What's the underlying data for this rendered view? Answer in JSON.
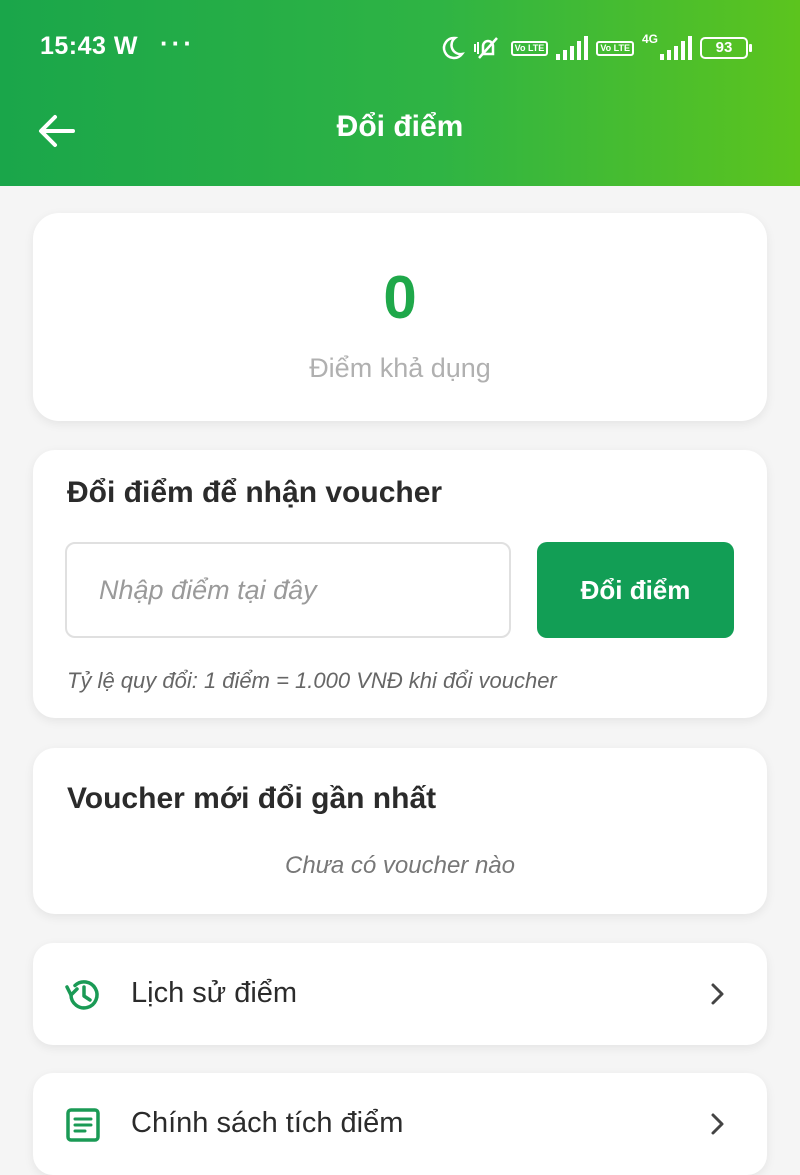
{
  "status_bar": {
    "time": "15:43 W",
    "dots": "···",
    "volte1": "Vo LTE",
    "volte2": "Vo LTE",
    "network": "4G",
    "battery": "93"
  },
  "header": {
    "title": "Đổi điểm"
  },
  "points": {
    "value": "0",
    "label": "Điểm khả dụng"
  },
  "redeem": {
    "title": "Đổi điểm để nhận voucher",
    "input_placeholder": "Nhập điểm tại đây",
    "button_label": "Đổi điểm",
    "rate_note": "Tỷ lệ quy đổi: 1 điểm = 1.000 VNĐ khi đổi voucher"
  },
  "recent_vouchers": {
    "title": "Voucher mới đổi gần nhất",
    "empty_text": "Chưa có voucher nào"
  },
  "menu": [
    {
      "label": "Lịch sử điểm",
      "icon": "history-icon"
    },
    {
      "label": "Chính sách tích điểm",
      "icon": "document-icon"
    }
  ],
  "colors": {
    "header_start": "#1aa64a",
    "header_end": "#5cc41e",
    "accent": "#129e55",
    "points_value": "#1fa84a"
  }
}
